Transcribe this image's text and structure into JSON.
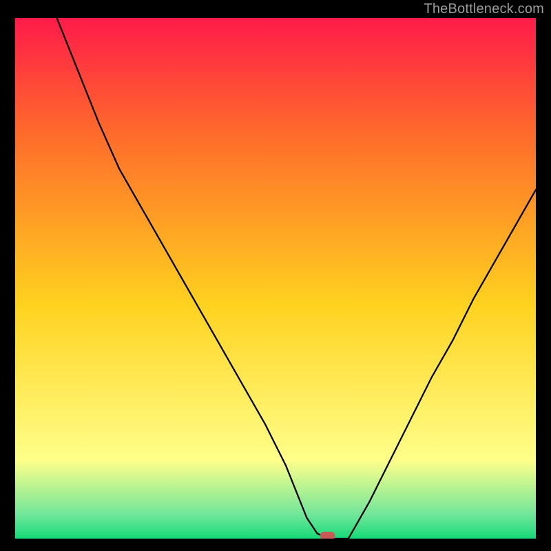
{
  "attribution": "TheBottleneck.com",
  "colors": {
    "background": "#000000",
    "gradient_top": "#ff1b4a",
    "gradient_upper_mid": "#ff6a2b",
    "gradient_mid": "#ffd21f",
    "gradient_lower": "#ffff8a",
    "gradient_band": "#6fe69a",
    "gradient_bottom": "#15d977",
    "curve_stroke": "#000000",
    "marker_fill": "#c75a57",
    "attribution_text": "#9c9c9c"
  },
  "chart_data": {
    "type": "line",
    "title": "",
    "xlabel": "",
    "ylabel": "",
    "xlim": [
      0,
      100
    ],
    "ylim": [
      0,
      100
    ],
    "x": [
      8,
      12,
      16,
      20,
      24,
      28,
      32,
      36,
      40,
      44,
      48,
      52,
      54,
      56,
      58,
      60,
      64,
      68,
      72,
      76,
      80,
      84,
      88,
      92,
      96,
      100
    ],
    "values": [
      100,
      90,
      80,
      71,
      64,
      57,
      50,
      43,
      36,
      29,
      22,
      14,
      9,
      4,
      1,
      0,
      0,
      7,
      15,
      23,
      31,
      38,
      46,
      53,
      60,
      67
    ],
    "annotations": [
      {
        "type": "marker",
        "x": 60,
        "y": 0
      }
    ]
  }
}
